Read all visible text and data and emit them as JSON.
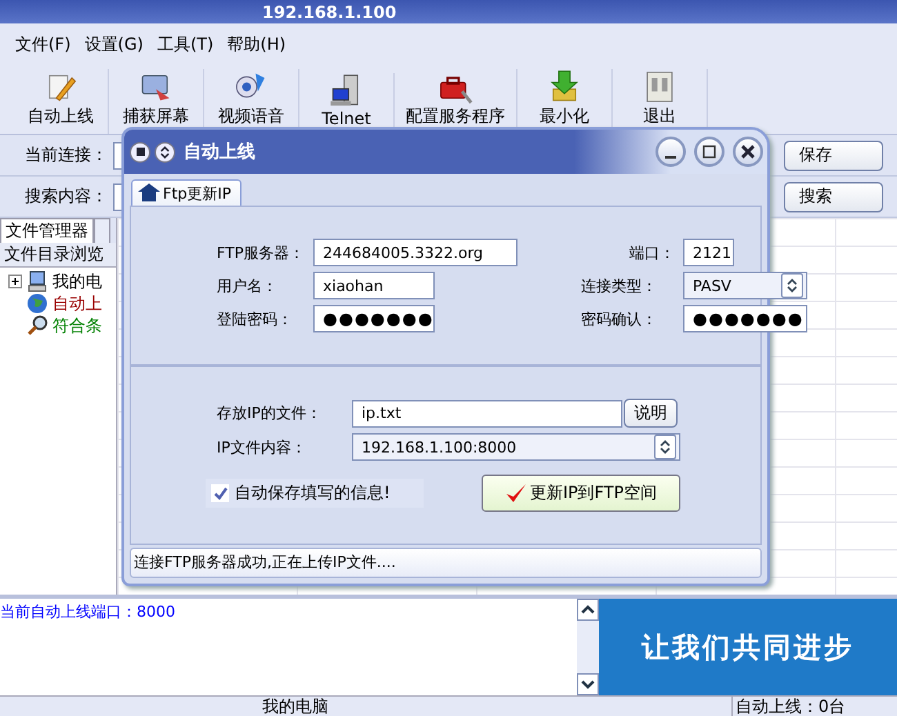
{
  "window": {
    "title_ip": "192.168.1.100"
  },
  "menu": [
    {
      "label": "文件(F)"
    },
    {
      "label": "设置(G)"
    },
    {
      "label": "工具(T)"
    },
    {
      "label": "帮助(H)"
    }
  ],
  "toolbar": [
    {
      "label": "自动上线"
    },
    {
      "label": "捕获屏幕"
    },
    {
      "label": "视频语音"
    },
    {
      "label": "Telnet"
    },
    {
      "label": "配置服务程序"
    },
    {
      "label": "最小化"
    },
    {
      "label": "退出"
    }
  ],
  "connection": {
    "label": "当前连接：",
    "button": "保存"
  },
  "search": {
    "label": "搜索内容：",
    "button": "搜索"
  },
  "left_tabs": [
    {
      "label": "文件管理器",
      "selected": true
    },
    {
      "selected": false
    }
  ],
  "browse_header": "文件目录浏览",
  "tree": [
    {
      "label": "我的电",
      "color": "#000000",
      "collapsible": true
    },
    {
      "label": "自动上",
      "color": "#990000",
      "collapsible": false
    },
    {
      "label": "符合条",
      "color": "#008000",
      "collapsible": false
    }
  ],
  "log": "当前自动上线端口：8000",
  "banner": "让我们共同进步",
  "status_bar": [
    "我的电脑",
    "自动上线：0台"
  ],
  "dialog": {
    "title": "自动上线",
    "tab": {
      "label": "Ftp更新IP",
      "selected": true
    },
    "server_label": "FTP服务器：",
    "server": "244684005.3322.org",
    "port_label": "端口：",
    "port": "2121",
    "user_label": "用户名：",
    "user": "xiaohan",
    "type_label": "连接类型：",
    "type": "PASV",
    "password_label": "登陆密码：",
    "password": "●●●●●●●",
    "confirm_label": "密码确认：",
    "confirm": "●●●●●●●",
    "file_label": "存放IP的文件：",
    "file": "ip.txt",
    "explain_button": "说明",
    "content_label": "IP文件内容：",
    "content": "192.168.1.100:8000",
    "autosave": {
      "label": "自动保存填写的信息!",
      "checked": true
    },
    "update_button": "更新IP到FTP空间",
    "status": "连接FTP服务器成功,正在上传IP文件...."
  }
}
